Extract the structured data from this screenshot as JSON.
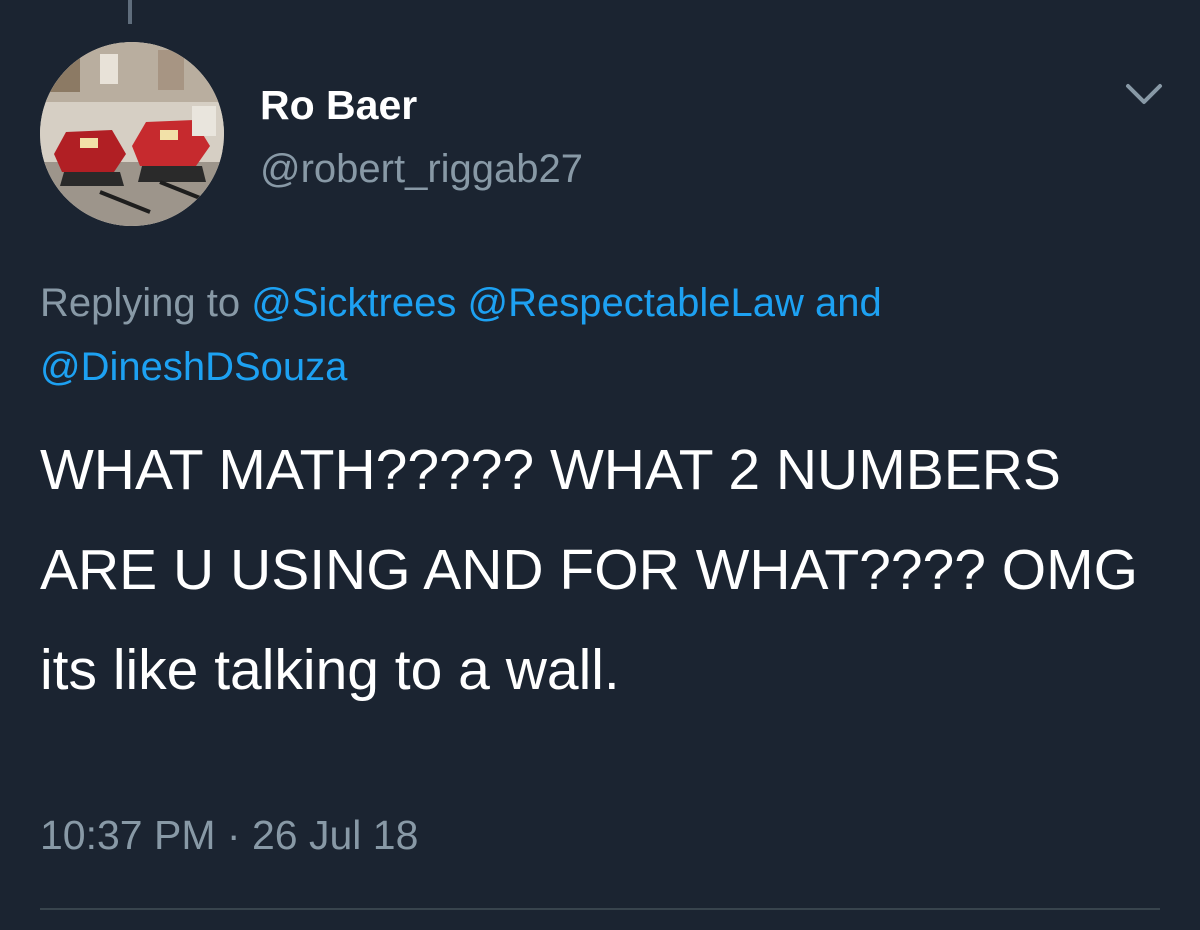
{
  "tweet": {
    "author": {
      "display_name": "Ro Baer",
      "handle": "@robert_riggab27",
      "avatar_description": "snowmobiles-photo"
    },
    "reply": {
      "prefix": "Replying to",
      "mentions": [
        "@Sicktrees",
        "@RespectableLaw",
        "@DineshDSouza"
      ],
      "conjunction": "and"
    },
    "text": "WHAT MATH????? WHAT 2 NUMBERS ARE U USING AND FOR WHAT???? OMG its like talking to a wall.",
    "time": "10:37 PM",
    "separator": "·",
    "date": "26 Jul 18"
  },
  "icons": {
    "menu": "chevron-down-icon"
  },
  "colors": {
    "background": "#1b2431",
    "primary_text": "#ffffff",
    "secondary_text": "#8899a6",
    "link": "#1da1f2",
    "divider": "#38444d"
  }
}
